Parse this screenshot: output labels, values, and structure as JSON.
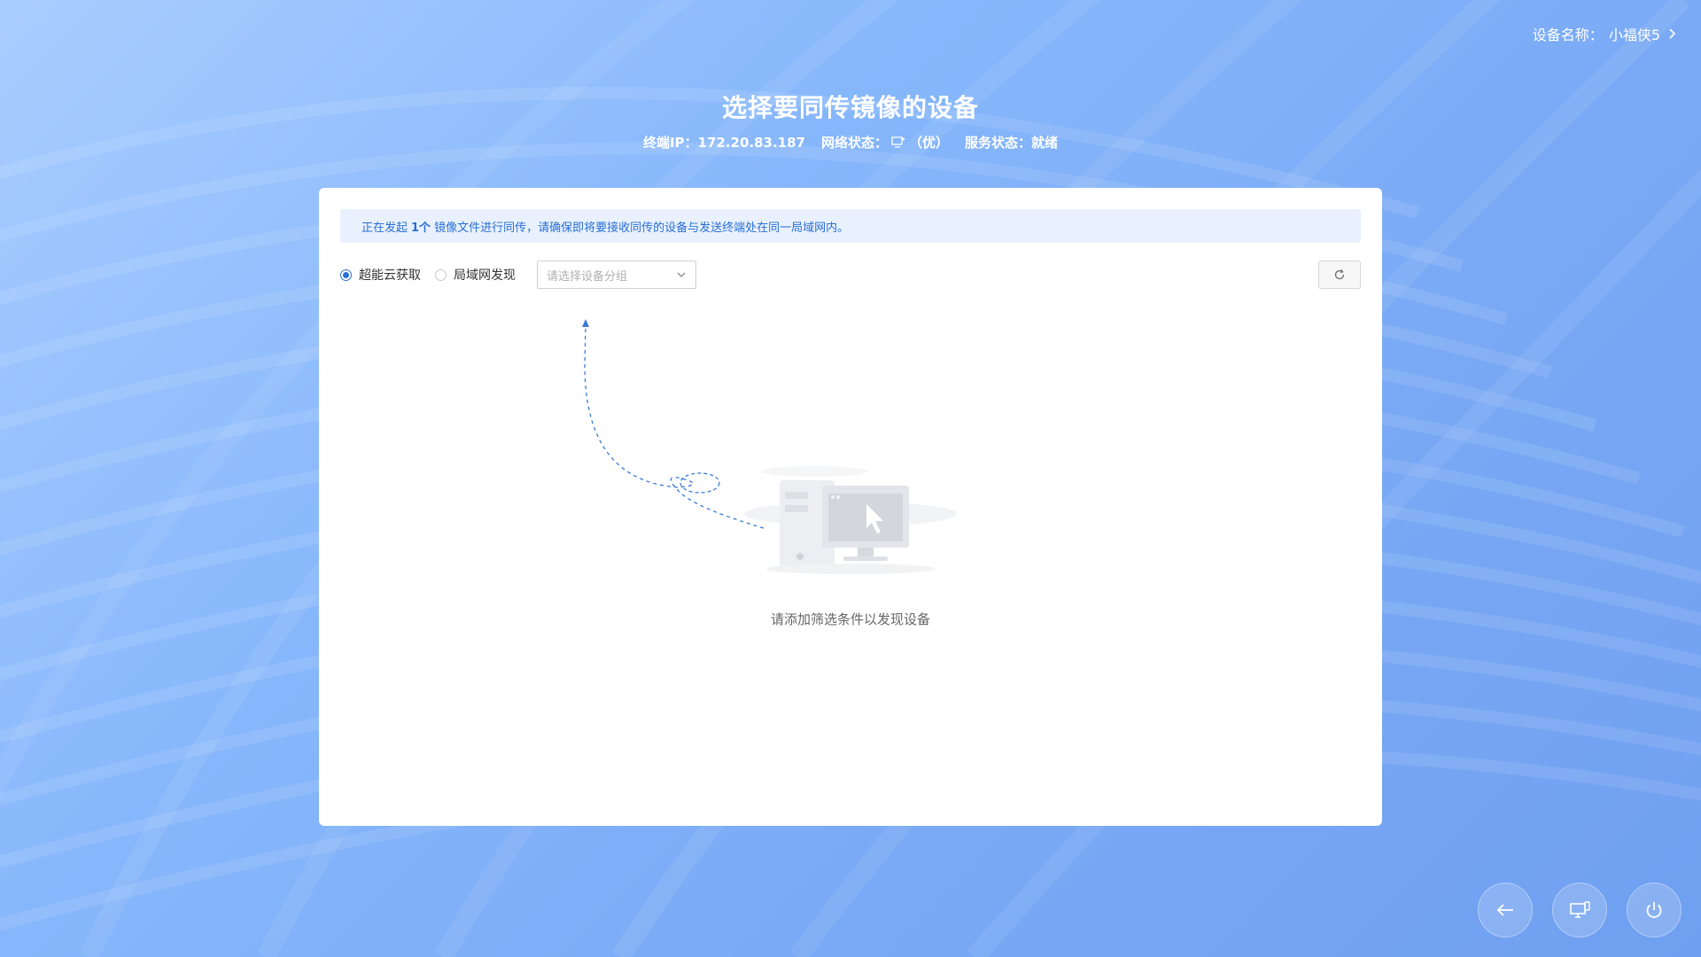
{
  "header": {
    "device_label": "设备名称：",
    "device_name": "小福侠5"
  },
  "title": "选择要同传镜像的设备",
  "status": {
    "ip_label": "终端IP：",
    "ip_value": "172.20.83.187",
    "network_label": "网络状态：",
    "network_value": "（优）",
    "service_label": "服务状态：",
    "service_value": "就绪"
  },
  "notice": {
    "prefix": "正在发起",
    "count": "1个",
    "suffix": "镜像文件进行同传，请确保即将要接收同传的设备与发送终端处在同一局域网内。"
  },
  "filters": {
    "options": [
      "超能云获取",
      "局域网发现"
    ],
    "selected": "超能云获取",
    "group_select": {
      "placeholder": "请选择设备分组"
    }
  },
  "empty_state": {
    "message": "请添加筛选条件以发现设备"
  },
  "icons": {
    "device_chevron": "chevron-right-icon",
    "network": "network-monitor-icon",
    "refresh": "refresh-icon",
    "select_arrow": "chevron-down-icon",
    "back": "arrow-left-icon",
    "monitor": "monitor-settings-icon",
    "power": "power-icon"
  },
  "colors": {
    "accent": "#2a6fd6",
    "notice_bg": "#e8f1fd",
    "background": "#87b7fb"
  }
}
